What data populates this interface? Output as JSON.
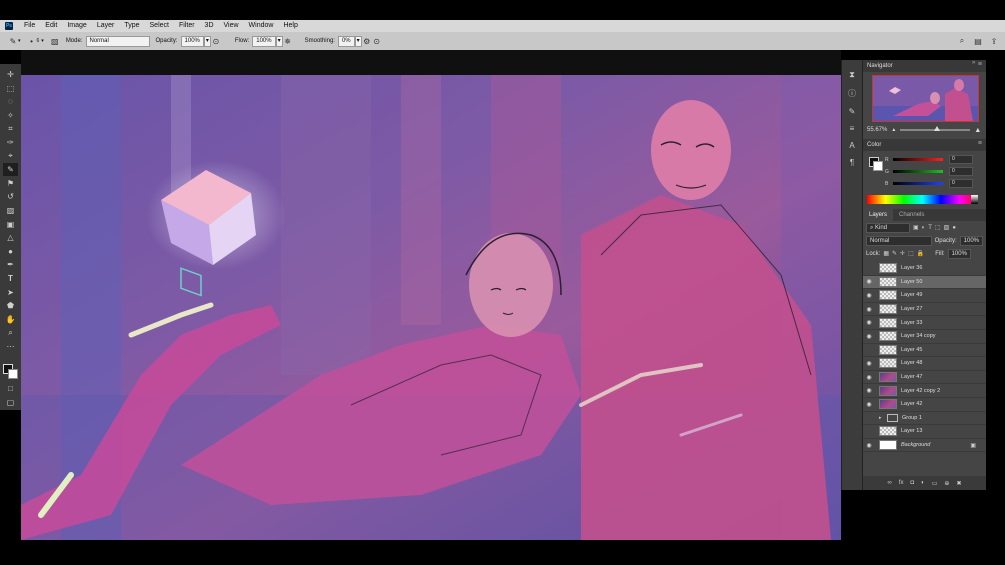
{
  "app": {
    "logo_text": "Ps",
    "menu": [
      "File",
      "Edit",
      "Image",
      "Layer",
      "Type",
      "Select",
      "Filter",
      "3D",
      "View",
      "Window",
      "Help"
    ]
  },
  "options_bar": {
    "brush_size": "6",
    "mode_label": "Mode:",
    "mode_value": "Normal",
    "opacity_label": "Opacity:",
    "opacity_value": "100%",
    "flow_label": "Flow:",
    "flow_value": "100%",
    "smoothing_label": "Smoothing:",
    "smoothing_value": "0%"
  },
  "navigator": {
    "title": "Navigator",
    "zoom": "55.67%",
    "zoom_fraction": 0.52
  },
  "color_panel": {
    "title": "Color",
    "channels": [
      {
        "label": "R",
        "value": "0",
        "color": "#ff2020"
      },
      {
        "label": "G",
        "value": "0",
        "color": "#20c020"
      },
      {
        "label": "B",
        "value": "0",
        "color": "#2040ff"
      }
    ]
  },
  "layers_panel": {
    "tabs": [
      "Layers",
      "Channels"
    ],
    "kind_label": "Kind",
    "blend_mode": "Normal",
    "opacity_label": "Opacity:",
    "opacity_value": "100%",
    "lock_label": "Lock:",
    "fill_label": "Fill:",
    "fill_value": "100%",
    "layers": [
      {
        "name": "Layer 36",
        "visible": false,
        "thumb": "transparent"
      },
      {
        "name": "Layer 50",
        "visible": true,
        "thumb": "transparent",
        "selected": true
      },
      {
        "name": "Layer 49",
        "visible": true,
        "thumb": "transparent"
      },
      {
        "name": "Layer 27",
        "visible": true,
        "thumb": "transparent"
      },
      {
        "name": "Layer 33",
        "visible": true,
        "thumb": "transparent"
      },
      {
        "name": "Layer 34 copy",
        "visible": true,
        "thumb": "transparent"
      },
      {
        "name": "Layer 45",
        "visible": false,
        "thumb": "transparent"
      },
      {
        "name": "Layer 48",
        "visible": true,
        "thumb": "transparent"
      },
      {
        "name": "Layer 47",
        "visible": true,
        "thumb": "painted"
      },
      {
        "name": "Layer 42 copy 2",
        "visible": true,
        "thumb": "painted"
      },
      {
        "name": "Layer 42",
        "visible": true,
        "thumb": "painted"
      },
      {
        "name": "Group 1",
        "visible": false,
        "thumb": "folder"
      },
      {
        "name": "Layer 13",
        "visible": false,
        "thumb": "transparent"
      },
      {
        "name": "Background",
        "visible": true,
        "thumb": "white",
        "locked": true
      }
    ]
  }
}
